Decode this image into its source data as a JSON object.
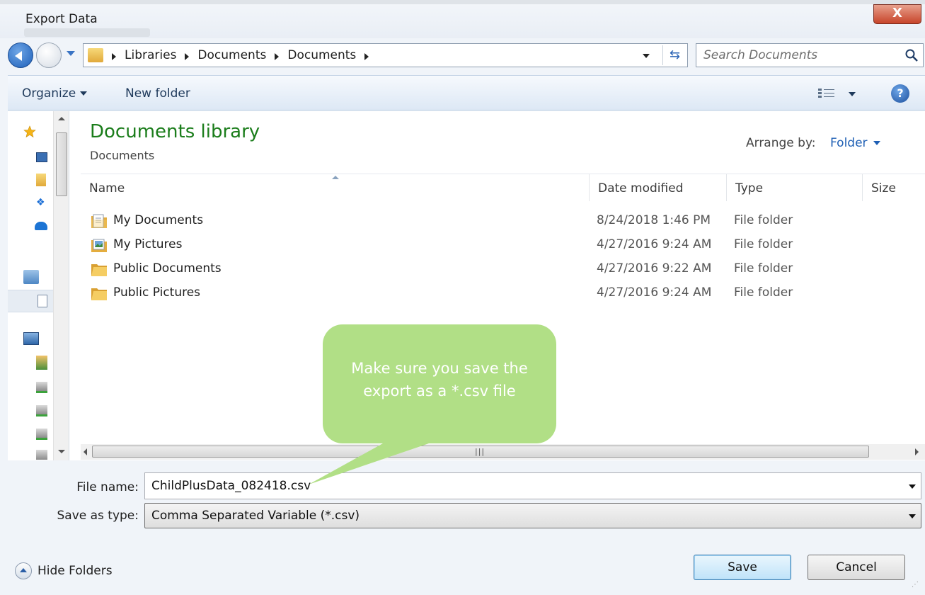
{
  "window": {
    "title": "Export Data",
    "close_label": "X"
  },
  "nav": {
    "breadcrumbs": [
      "Libraries",
      "Documents",
      "Documents"
    ],
    "search_placeholder": "Search Documents"
  },
  "toolbar": {
    "organize_label": "Organize",
    "new_folder_label": "New folder",
    "help_label": "?"
  },
  "library": {
    "title": "Documents library",
    "subtitle": "Documents",
    "arrange_label": "Arrange by:",
    "arrange_value": "Folder"
  },
  "columns": [
    "Name",
    "Date modified",
    "Type",
    "Size"
  ],
  "files": [
    {
      "name": "My Documents",
      "date": "8/24/2018 1:46 PM",
      "type": "File folder",
      "icon": "documents-folder-icon"
    },
    {
      "name": "My Pictures",
      "date": "4/27/2016 9:24 AM",
      "type": "File folder",
      "icon": "pictures-folder-icon"
    },
    {
      "name": "Public Documents",
      "date": "4/27/2016 9:22 AM",
      "type": "File folder",
      "icon": "folder-icon"
    },
    {
      "name": "Public Pictures",
      "date": "4/27/2016 9:24 AM",
      "type": "File folder",
      "icon": "folder-icon"
    }
  ],
  "form": {
    "file_name_label": "File name:",
    "file_name_value": "ChildPlusData_082418.csv",
    "save_type_label": "Save as type:",
    "save_type_value": "Comma Separated Variable (*.csv)"
  },
  "footer": {
    "hide_folders_label": "Hide Folders",
    "save_label": "Save",
    "cancel_label": "Cancel"
  },
  "callout": {
    "line1": "Make sure you save the",
    "line2": "export as a *.csv file",
    "color": "#b1df86"
  },
  "colors": {
    "accent": "#1e5fb4",
    "library_title": "#1b7d1b"
  }
}
